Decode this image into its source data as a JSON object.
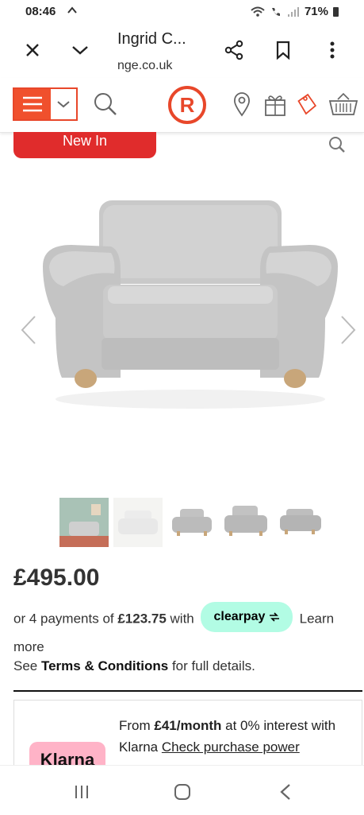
{
  "status_bar": {
    "time": "08:46",
    "battery": "71%",
    "indicators": "signal-wifi-icons"
  },
  "browser": {
    "tab_title": "Ingrid C...",
    "url": "nge.co.uk",
    "icons": [
      "close-icon",
      "chevron-down-icon",
      "share-icon",
      "bookmark-icon",
      "more-vert-icon"
    ]
  },
  "site_header": {
    "logo_letter": "R",
    "icons": [
      "menu-icon",
      "chevron-down-icon",
      "search-icon",
      "location-pin-icon",
      "gift-icon",
      "tag-icon",
      "basket-icon"
    ]
  },
  "product": {
    "new_in_label": "New In",
    "price": "£495.00",
    "installment_prefix": "or 4 payments of ",
    "installment_amount": "£123.75",
    "installment_suffix": " with ",
    "clearpay_label": "clearpay",
    "learn_more": "Learn more",
    "terms_prefix": "See ",
    "terms_link": "Terms & Conditions",
    "terms_suffix": " for full details.",
    "thumbnail_count": 5
  },
  "klarna": {
    "logo": "Klarna",
    "line_prefix": "From ",
    "monthly": "£41/month",
    "line_mid": " at 0% interest with Klarna ",
    "link": "Check purchase power"
  },
  "colors": {
    "brand": "#e8472a",
    "new_in": "#e02c2c",
    "clearpay": "#b2fce4",
    "klarna": "#ffb3c7"
  }
}
